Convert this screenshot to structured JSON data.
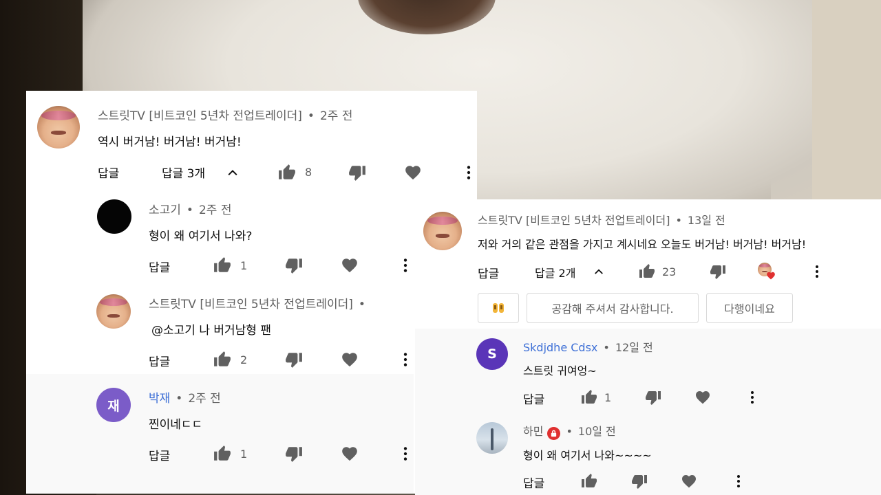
{
  "left_thread": {
    "top_comment": {
      "author": "스트릿TV [비트코인 5년차 전업트레이더]",
      "time": "2주 전",
      "text": "역시 버거남! 버거남! 버거남!",
      "reply_label": "답글",
      "replies_toggle": "답글 3개",
      "likes": "8"
    },
    "replies": [
      {
        "author": "소고기",
        "time": "2주 전",
        "text": "형이 왜 여기서 나와?",
        "reply_label": "답글",
        "likes": "1"
      },
      {
        "author": "스트릿TV [비트코인 5년차 전업트레이더]",
        "time": "",
        "text": "@소고기  나 버거남형 팬",
        "reply_label": "답글",
        "likes": "2"
      },
      {
        "author": "박재",
        "avatar_letter": "재",
        "time": "2주 전",
        "text": "찐이네ㄷㄷ",
        "reply_label": "답글",
        "likes": "1"
      }
    ]
  },
  "right_thread": {
    "top_comment": {
      "author": "스트릿TV [비트코인 5년차 전업트레이더]",
      "time": "13일 전",
      "text": "저와 거의 같은 관점을 가지고 계시네요 오늘도 버거남! 버거남! 버거남!",
      "reply_label": "답글",
      "replies_toggle": "답글 2개",
      "likes": "23"
    },
    "suggestions": [
      "공감해 주셔서 감사합니다.",
      "다행이네요"
    ],
    "replies": [
      {
        "author": "Skdjdhe Cdsx",
        "avatar_letter": "S",
        "time": "12일 전",
        "text": "스트릿 귀여엉~",
        "reply_label": "답글",
        "likes": "1"
      },
      {
        "author": "하민",
        "time": "10일 전",
        "text": "형이 왜 여기서 나와~~~~",
        "reply_label": "답글",
        "likes": ""
      }
    ]
  },
  "colors": {
    "reply_avatar_purple": "#7b5cc8",
    "s_avatar_purple": "#5a35b8",
    "link_blue": "#3d6fd6",
    "heart_red": "#e03030"
  },
  "icons": [
    "thumb-up-icon",
    "thumb-down-icon",
    "heart-icon",
    "more-vert-icon",
    "chevron-up-icon",
    "creator-heart-icon",
    "emoji-icon",
    "lock-icon"
  ]
}
